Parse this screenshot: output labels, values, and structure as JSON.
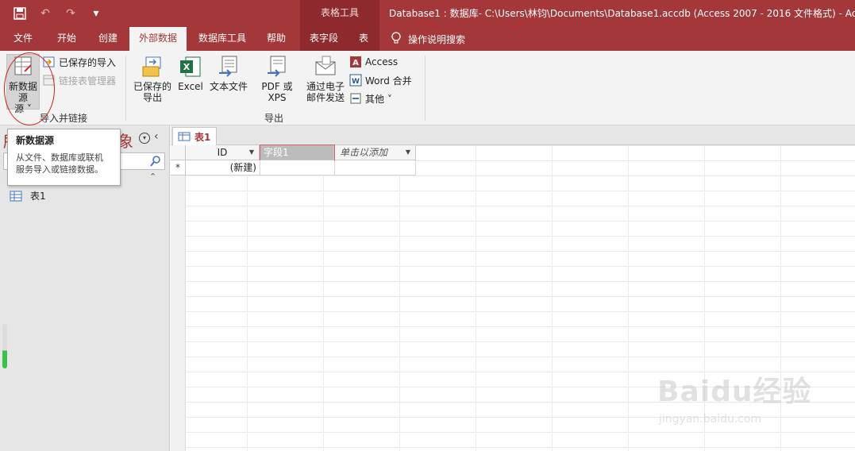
{
  "title_bar": {
    "contextual_label": "表格工具",
    "window_title": "Database1 : 数据库- C:\\Users\\林钧\\Documents\\Database1.accdb (Access 2007 - 2016 文件格式)  -  Acc",
    "qat_icons": [
      "save-icon",
      "undo-icon",
      "redo-icon",
      "customize-icon"
    ]
  },
  "tabs": {
    "file": "文件",
    "home": "开始",
    "create": "创建",
    "external_data": "外部数据",
    "database_tools": "数据库工具",
    "help": "帮助",
    "table_fields": "表字段",
    "table": "表",
    "tell_me": "操作说明搜索"
  },
  "ribbon": {
    "import_group": {
      "label": "导入并链接",
      "new_source": "新数据源",
      "new_source_line2": "源 ˅",
      "saved_imports": "已保存的导入",
      "linked_table_manager": "链接表管理器"
    },
    "export_group": {
      "label": "导出",
      "saved_exports_1": "已保存的",
      "saved_exports_2": "导出",
      "excel": "Excel",
      "text_file": "文本文件",
      "pdf_xps": "PDF 或 XPS",
      "email_1": "通过电子",
      "email_2": "邮件发送",
      "access": "Access",
      "word_merge": "Word 合并",
      "more": "其他 ˅"
    }
  },
  "tooltip": {
    "title": "新数据源",
    "desc_line1": "从文件、数据库或联机",
    "desc_line2": "服务导入或链接数据。"
  },
  "nav_pane": {
    "header_left": "所",
    "header_right": "象",
    "items": [
      {
        "label": "表1"
      }
    ]
  },
  "document": {
    "tab_label": "表1",
    "columns": [
      {
        "header": "ID",
        "has_dropdown": true
      },
      {
        "header": "字段1",
        "has_dropdown": false,
        "selected": true
      },
      {
        "header": "单击以添加",
        "has_dropdown": true
      }
    ],
    "new_row_marker": "*",
    "new_row_id": "(新建)"
  },
  "watermark": {
    "brand": "Bai",
    "brand2": "du",
    "brand3": "经验",
    "url": "jingyan.baidu.com"
  },
  "colors": {
    "accent": "#a4373a",
    "contextual": "#8e2a2d",
    "annotation": "#d02020"
  }
}
